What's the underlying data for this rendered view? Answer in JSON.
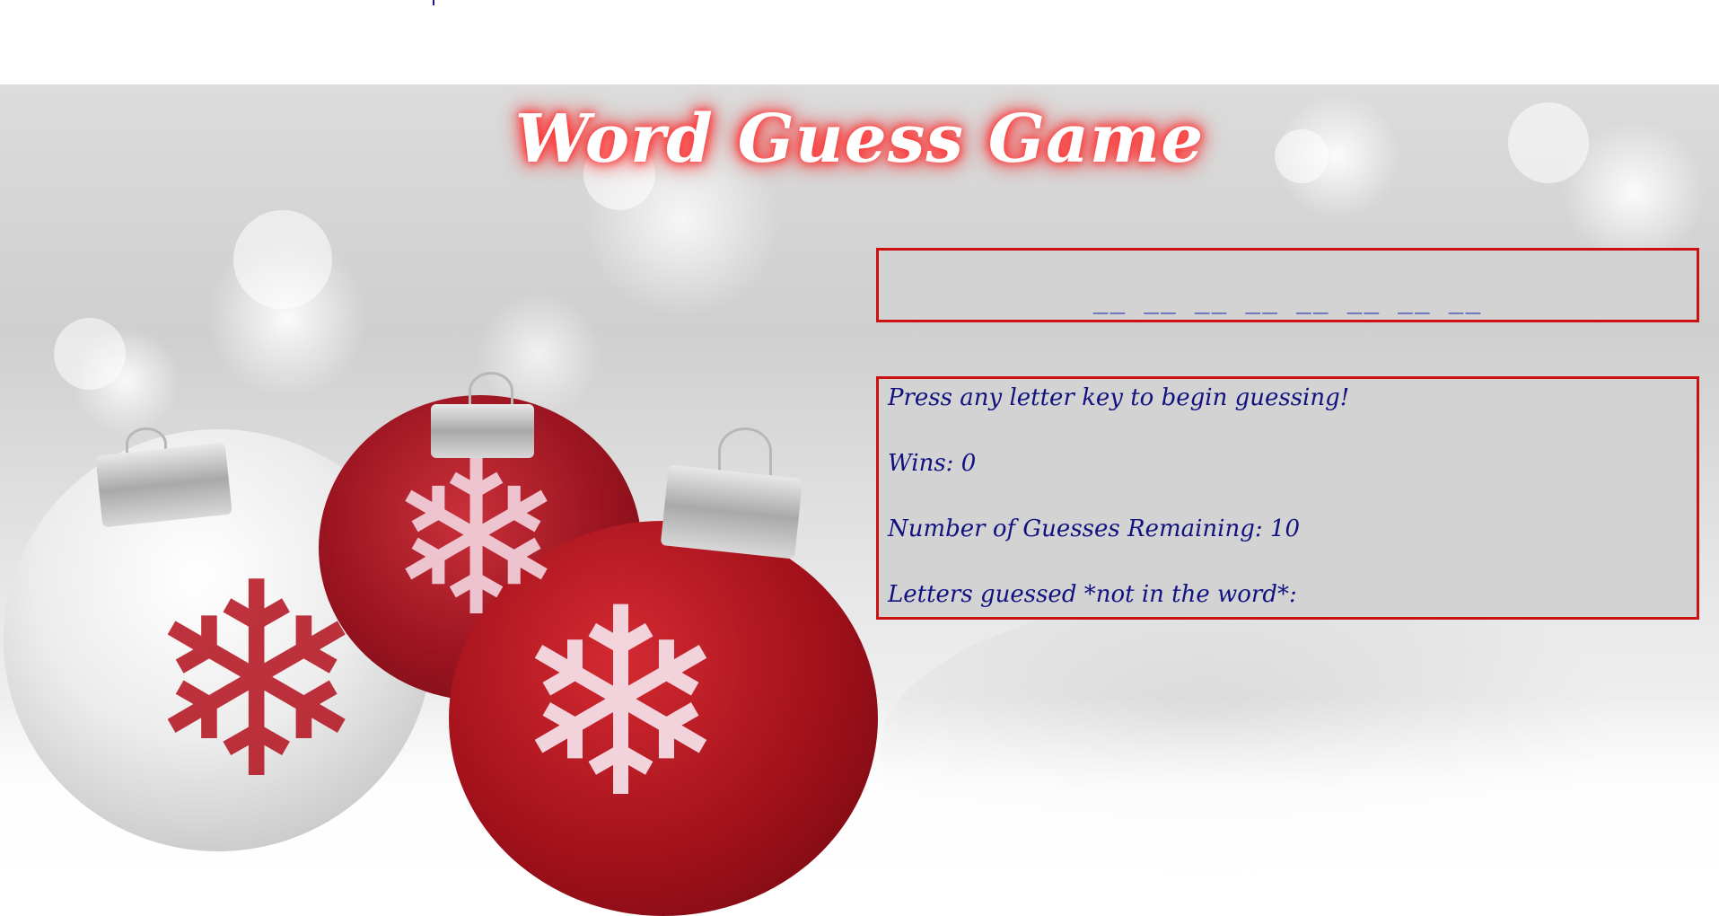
{
  "title": "Word Guess Game",
  "word_blanks": "__ __ __ __ __ __ __ __",
  "info": {
    "prompt": "Press any letter key to begin guessing!",
    "wins": "Wins: 0",
    "guesses_remaining": "Number of Guesses Remaining: 10",
    "letters_guessed": "Letters guessed *not in the word*:"
  },
  "colors": {
    "panel_bg": "#d3d3d3",
    "panel_border": "#cc1111",
    "text": "#111180",
    "title_glow": "#ff2a2a"
  },
  "icons": {
    "ornament_snowflake": "snowflake-icon"
  }
}
